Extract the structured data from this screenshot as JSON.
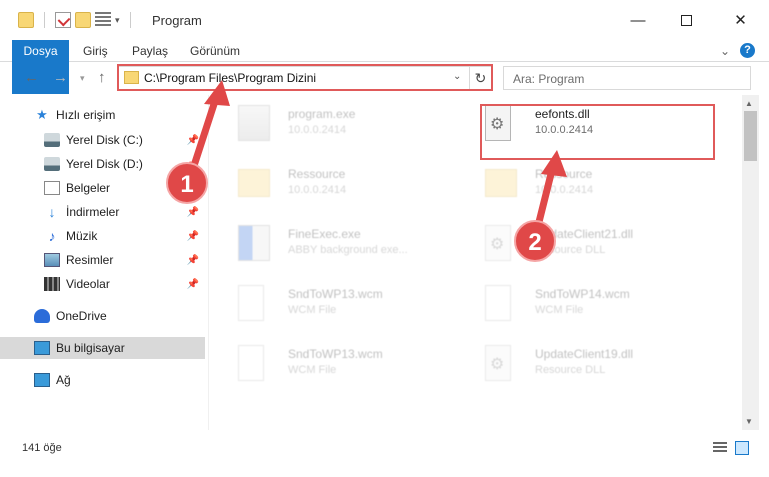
{
  "window": {
    "title": "Program",
    "minimize": "—",
    "close": "✕"
  },
  "ribbon": {
    "tabs": [
      "Dosya",
      "Giriş",
      "Paylaş",
      "Görünüm"
    ],
    "expand": "⌄",
    "help": "?"
  },
  "nav": {
    "back": "←",
    "forward": "→",
    "recent": "▾",
    "up": "↑",
    "address": "C:\\Program Files\\Program Dizini",
    "address_dropdown": "⌄",
    "refresh": "↻",
    "search_placeholder": "Ara: Program"
  },
  "sidebar": {
    "items": [
      {
        "label": "Hızlı erişim",
        "icon": "star-icon",
        "pinned": false
      },
      {
        "label": "Yerel Disk (C:)",
        "icon": "disk-icon",
        "pinned": true
      },
      {
        "label": "Yerel Disk (D:)",
        "icon": "disk-icon",
        "pinned": true
      },
      {
        "label": "Belgeler",
        "icon": "document-icon",
        "pinned": true
      },
      {
        "label": "İndirmeler",
        "icon": "download-icon",
        "pinned": true
      },
      {
        "label": "Müzik",
        "icon": "music-icon",
        "pinned": true
      },
      {
        "label": "Resimler",
        "icon": "pictures-icon",
        "pinned": true
      },
      {
        "label": "Videolar",
        "icon": "video-icon",
        "pinned": true
      },
      {
        "label": "OneDrive",
        "icon": "cloud-icon",
        "pinned": false
      },
      {
        "label": "Bu bilgisayar",
        "icon": "computer-icon",
        "pinned": false
      },
      {
        "label": "Ağ",
        "icon": "network-icon",
        "pinned": false
      }
    ],
    "pin_glyph": "📌"
  },
  "files": [
    {
      "name": "program.exe",
      "desc": "10.0.0.2414",
      "icon": "exe-icon"
    },
    {
      "name": "eefonts.dll",
      "desc": "10.0.0.2414",
      "icon": "dll-icon"
    },
    {
      "name": "Ressource",
      "desc": "10.0.0.2414",
      "icon": "folder-icon"
    },
    {
      "name": "Ressource",
      "desc": "10.0.0.2414",
      "icon": "folder-icon"
    },
    {
      "name": "FineExec.exe",
      "desc": "ABBY background exe...",
      "icon": "app-icon"
    },
    {
      "name": "UpdateClient21.dll",
      "desc": "Resource DLL",
      "icon": "dll-icon"
    },
    {
      "name": "SndToWP13.wcm",
      "desc": "WCM File",
      "icon": "blank-file-icon"
    },
    {
      "name": "SndToWP14.wcm",
      "desc": "WCM File",
      "icon": "blank-file-icon"
    },
    {
      "name": "SndToWP13.wcm",
      "desc": "WCM File",
      "icon": "blank-file-icon"
    },
    {
      "name": "UpdateClient19.dll",
      "desc": "Resource DLL",
      "icon": "dll-icon"
    }
  ],
  "status": {
    "count": "141 öğe"
  },
  "markers": [
    "1",
    "2"
  ],
  "colors": {
    "accent": "#1979ca",
    "highlight": "#e05a5a"
  }
}
